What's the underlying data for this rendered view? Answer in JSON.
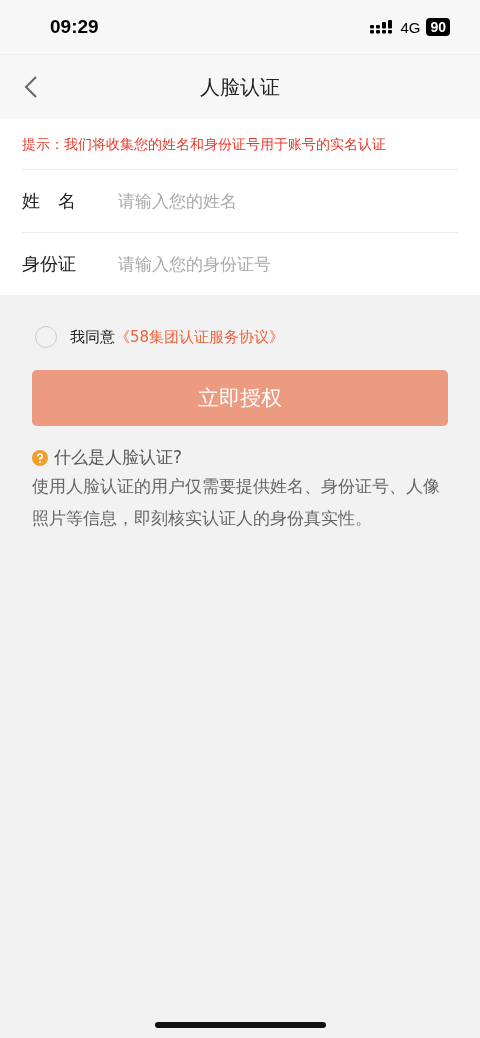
{
  "status_bar": {
    "time": "09:29",
    "network": "4G",
    "battery": "90"
  },
  "nav": {
    "title": "人脸认证"
  },
  "notice": "提示：我们将收集您的姓名和身份证号用于账号的实名认证",
  "fields": [
    {
      "label": "姓　名",
      "placeholder": "请输入您的姓名"
    },
    {
      "label": "身份证",
      "placeholder": "请输入您的身份证号"
    }
  ],
  "agreement": {
    "checked": false,
    "text": "我同意",
    "link": "《58集团认证服务协议》"
  },
  "submit": {
    "label": "立即授权",
    "disabled": true
  },
  "help": {
    "title": "什么是人脸认证?",
    "body": "使用人脸认证的用户仅需要提供姓名、身份证号、人像照片等信息，即刻核实认证人的身份真实性。"
  }
}
